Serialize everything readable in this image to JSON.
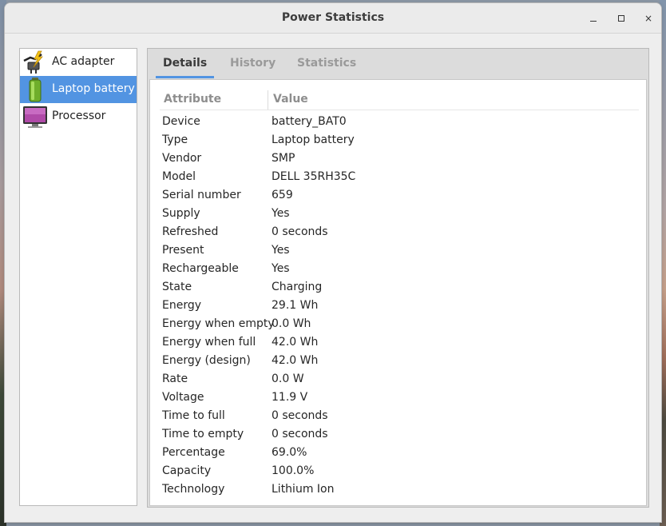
{
  "window": {
    "title": "Power Statistics",
    "buttons": {
      "minimize": "minimize",
      "maximize": "maximize",
      "close": "×"
    }
  },
  "sidebar": {
    "items": [
      {
        "label": "AC adapter",
        "icon": "ac-adapter-icon",
        "selected": false
      },
      {
        "label": "Laptop battery",
        "icon": "battery-icon",
        "selected": true
      },
      {
        "label": "Processor",
        "icon": "monitor-icon",
        "selected": false
      }
    ]
  },
  "tabs": [
    {
      "label": "Details",
      "active": true
    },
    {
      "label": "History",
      "active": false
    },
    {
      "label": "Statistics",
      "active": false
    }
  ],
  "table": {
    "columns": {
      "attribute": "Attribute",
      "value": "Value"
    },
    "rows": [
      {
        "k": "Device",
        "v": "battery_BAT0"
      },
      {
        "k": "Type",
        "v": "Laptop battery"
      },
      {
        "k": "Vendor",
        "v": "SMP"
      },
      {
        "k": "Model",
        "v": "DELL 35RH35C"
      },
      {
        "k": "Serial number",
        "v": "659"
      },
      {
        "k": "Supply",
        "v": "Yes"
      },
      {
        "k": "Refreshed",
        "v": "0 seconds"
      },
      {
        "k": "Present",
        "v": "Yes"
      },
      {
        "k": "Rechargeable",
        "v": "Yes"
      },
      {
        "k": "State",
        "v": "Charging"
      },
      {
        "k": "Energy",
        "v": "29.1 Wh"
      },
      {
        "k": "Energy when empty",
        "v": "0.0 Wh"
      },
      {
        "k": "Energy when full",
        "v": "42.0 Wh"
      },
      {
        "k": "Energy (design)",
        "v": "42.0 Wh"
      },
      {
        "k": "Rate",
        "v": "0.0 W"
      },
      {
        "k": "Voltage",
        "v": "11.9 V"
      },
      {
        "k": "Time to full",
        "v": "0 seconds"
      },
      {
        "k": "Time to empty",
        "v": "0 seconds"
      },
      {
        "k": "Percentage",
        "v": "69.0%"
      },
      {
        "k": "Capacity",
        "v": "100.0%"
      },
      {
        "k": "Technology",
        "v": "Lithium Ion"
      }
    ]
  },
  "colors": {
    "accent": "#5294e2",
    "window_bg": "#eeeeee"
  }
}
